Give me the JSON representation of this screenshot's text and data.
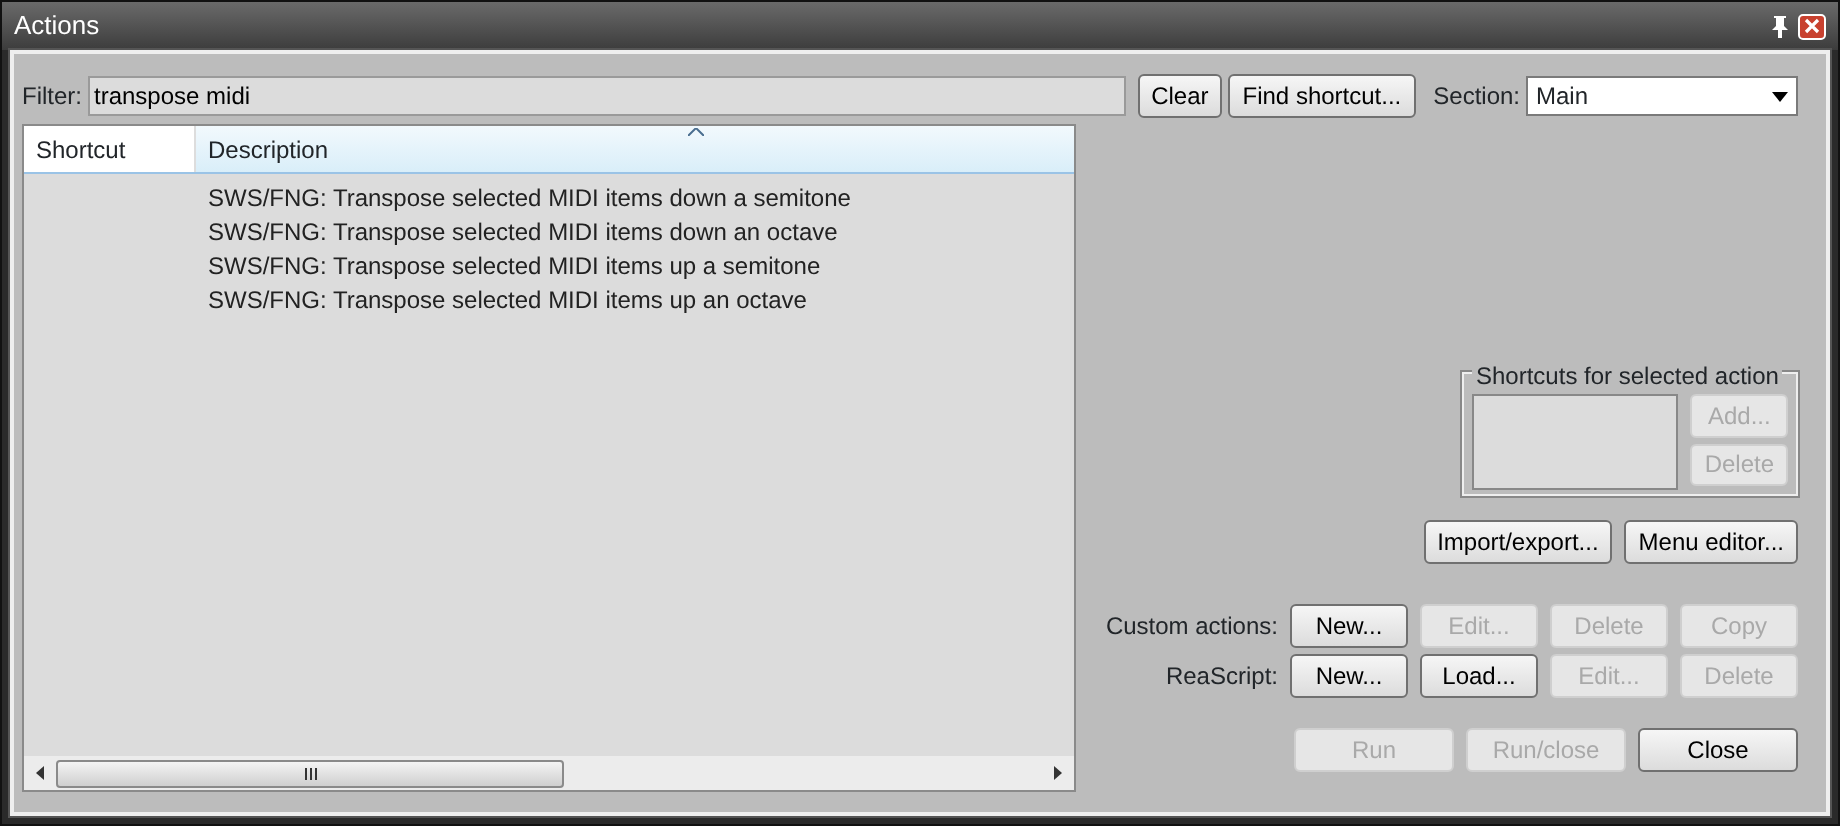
{
  "window": {
    "title": "Actions"
  },
  "filter": {
    "label": "Filter:",
    "value": "transpose midi"
  },
  "toolbar_buttons": [
    {
      "label": "Clear",
      "disabled": false
    },
    {
      "label": "Find shortcut...",
      "disabled": false
    }
  ],
  "section": {
    "label": "Section:",
    "value": "Main"
  },
  "table": {
    "columns": [
      "Shortcut",
      "Description"
    ],
    "rows": [
      {
        "shortcut": "",
        "description": "SWS/FNG: Transpose selected MIDI items down a semitone"
      },
      {
        "shortcut": "",
        "description": "SWS/FNG: Transpose selected MIDI items down an octave"
      },
      {
        "shortcut": "",
        "description": "SWS/FNG: Transpose selected MIDI items up a semitone"
      },
      {
        "shortcut": "",
        "description": "SWS/FNG: Transpose selected MIDI items up an octave"
      }
    ]
  },
  "shortcuts_group": {
    "title": "Shortcuts for selected action",
    "buttons": [
      {
        "label": "Add...",
        "disabled": true
      },
      {
        "label": "Delete",
        "disabled": true
      }
    ]
  },
  "tool_buttons": [
    {
      "label": "Import/export...",
      "disabled": false
    },
    {
      "label": "Menu editor...",
      "disabled": false
    }
  ],
  "action_rows": [
    {
      "label": "Custom actions:",
      "buttons": [
        {
          "label": "New...",
          "disabled": false
        },
        {
          "label": "Edit...",
          "disabled": true
        },
        {
          "label": "Delete",
          "disabled": true
        },
        {
          "label": "Copy",
          "disabled": true
        }
      ]
    },
    {
      "label": "ReaScript:",
      "buttons": [
        {
          "label": "New...",
          "disabled": false
        },
        {
          "label": "Load...",
          "disabled": false
        },
        {
          "label": "Edit...",
          "disabled": true
        },
        {
          "label": "Delete",
          "disabled": true
        }
      ]
    }
  ],
  "bottom_buttons": [
    {
      "label": "Run",
      "disabled": true
    },
    {
      "label": "Run/close",
      "disabled": true
    },
    {
      "label": "Close",
      "disabled": false
    }
  ]
}
